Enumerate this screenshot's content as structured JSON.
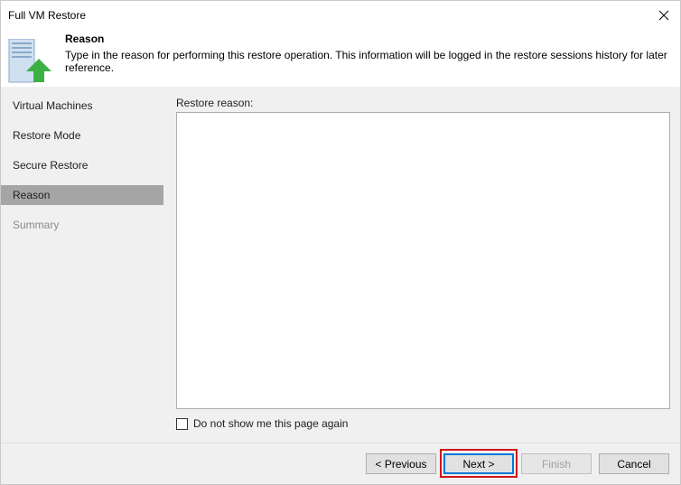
{
  "window": {
    "title": "Full VM Restore"
  },
  "header": {
    "title": "Reason",
    "description": "Type in the reason for performing this restore operation. This information will be logged in the restore sessions history for later reference."
  },
  "sidebar": {
    "items": [
      {
        "label": "Virtual Machines",
        "state": "normal"
      },
      {
        "label": "Restore Mode",
        "state": "normal"
      },
      {
        "label": "Secure Restore",
        "state": "normal"
      },
      {
        "label": "Reason",
        "state": "active"
      },
      {
        "label": "Summary",
        "state": "disabled"
      }
    ]
  },
  "content": {
    "reason_label": "Restore reason:",
    "reason_value": "",
    "checkbox_label": "Do not show me this page again",
    "checkbox_checked": false
  },
  "footer": {
    "previous_label": "< Previous",
    "next_label": "Next >",
    "finish_label": "Finish",
    "cancel_label": "Cancel"
  },
  "colors": {
    "active_item_bg": "#a5a5a5",
    "highlight_border": "#d0161c",
    "focus_border": "#0078d7",
    "arrow_green": "#3cb043"
  }
}
